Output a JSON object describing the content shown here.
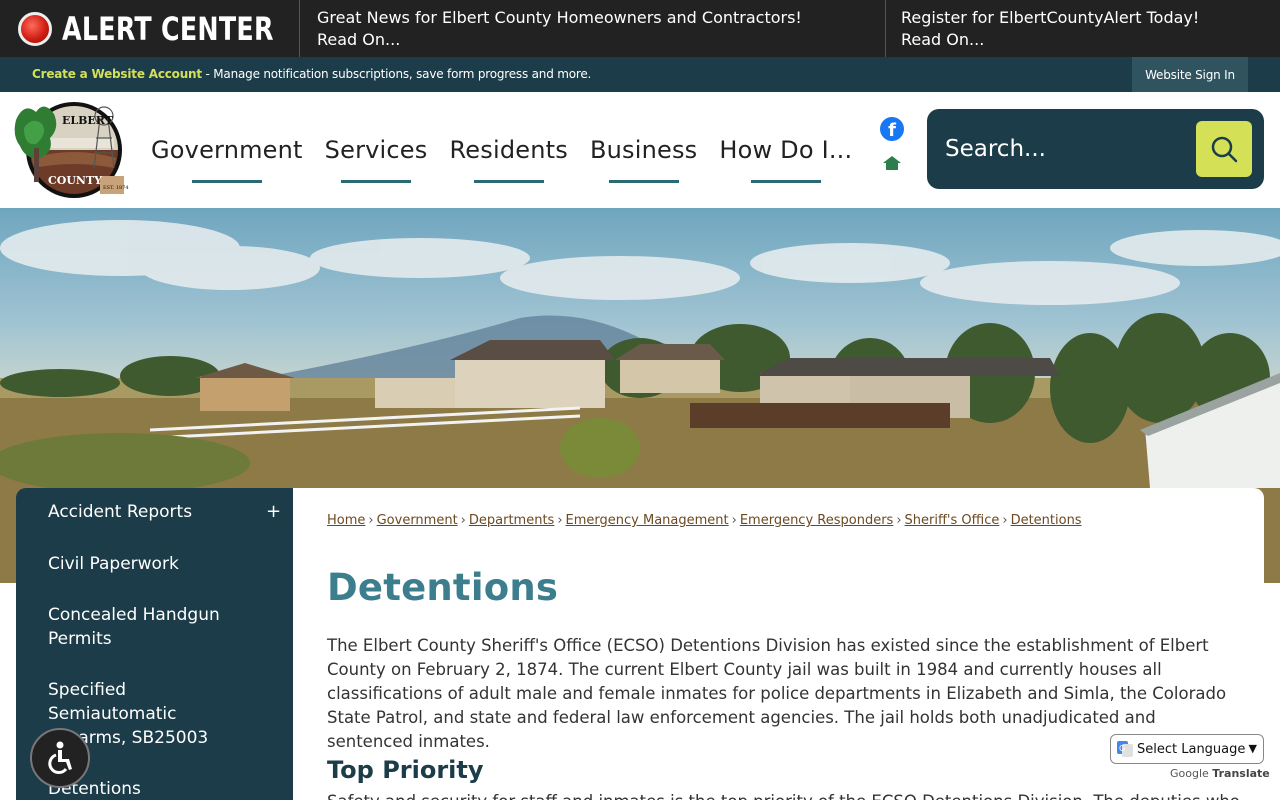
{
  "alert": {
    "title": "ALERT CENTER",
    "items": [
      {
        "headline": "Great News for Elbert County Homeowners and Contractors!",
        "more": "Read On..."
      },
      {
        "headline": "Register for ElbertCountyAlert Today!",
        "more": "Read On..."
      }
    ]
  },
  "account": {
    "create_link": "Create a Website Account",
    "message": " - Manage notification subscriptions, save form progress and more.",
    "signin": "Website Sign In"
  },
  "logo": {
    "top_text": "ELBERT",
    "bottom_text": "COUNTY",
    "est": "EST. 1874"
  },
  "nav": [
    "Government",
    "Services",
    "Residents",
    "Business",
    "How Do I..."
  ],
  "social": {
    "facebook_glyph": "f"
  },
  "search": {
    "placeholder": "Search..."
  },
  "sidebar": {
    "items": [
      "Accident Reports",
      "Civil Paperwork",
      "Concealed Handgun Permits",
      "Specified Semiautomatic Firearms, SB25003",
      "Detentions"
    ],
    "expand_glyph": "+"
  },
  "breadcrumb": [
    "Home",
    "Government",
    "Departments",
    "Emergency Management",
    "Emergency Responders",
    "Sheriff's Office",
    "Detentions"
  ],
  "breadcrumb_separator": "›",
  "page": {
    "title": "Detentions",
    "intro": "The Elbert County Sheriff's Office (ECSO) Detentions Division has existed since the establishment of Elbert County on February 2, 1874. The current Elbert County jail was built in 1984 and currently houses all classifications of adult male and female inmates for police departments in Elizabeth and Simla, the Colorado State Patrol, and state and federal law enforcement agencies. The jail holds both unadjudicated and sentenced inmates.",
    "section_title": "Top Priority",
    "section_text": "Safety and security for staff and inmates is the top priority of the ECSO Detentions Division. The deputies who"
  },
  "translate": {
    "label": "Select Language",
    "powered_by": "Google",
    "translate_word": "Translate"
  },
  "colors": {
    "brand_dark": "#1b3c48",
    "accent": "#d4e157",
    "title": "#3d7e8e",
    "link": "#6b4a22",
    "alert_bg": "#222222"
  }
}
